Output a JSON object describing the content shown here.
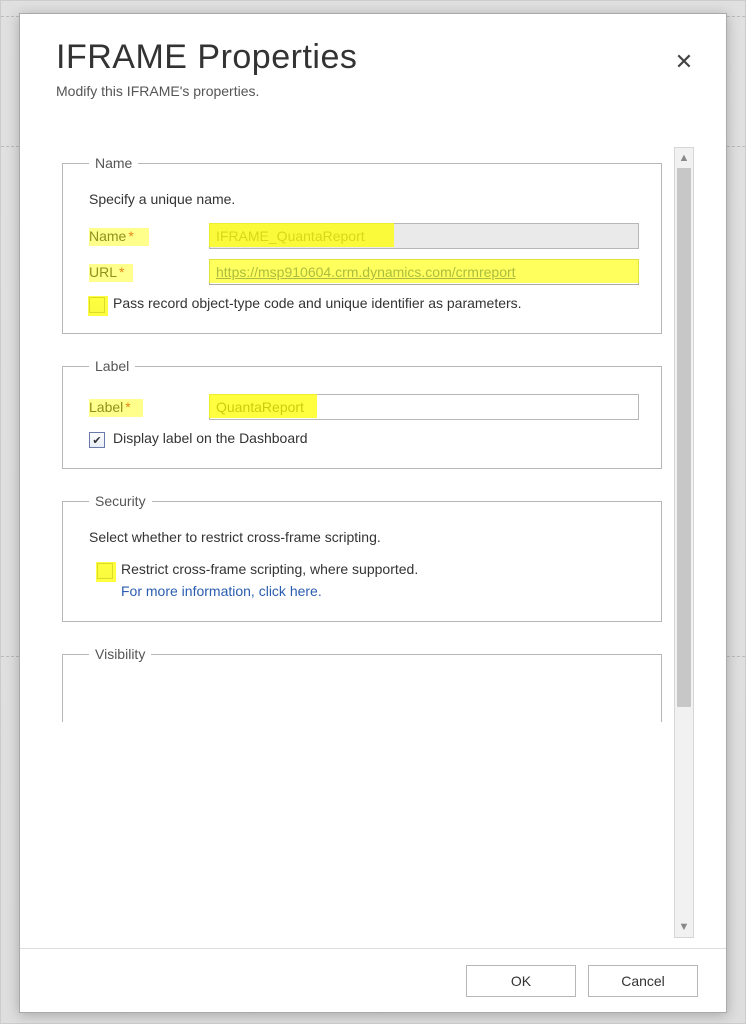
{
  "dialog": {
    "title": "IFRAME Properties",
    "subtitle": "Modify this IFRAME's properties.",
    "close_icon": "✕"
  },
  "groups": {
    "name": {
      "legend": "Name",
      "desc": "Specify a unique name.",
      "name_label": "Name",
      "name_value": "IFRAME_QuantaReport",
      "url_label": "URL",
      "url_value": "https://msp910604.crm.dynamics.com/crmreport",
      "pass_params_label": "Pass record object-type code and unique identifier as parameters."
    },
    "label": {
      "legend": "Label",
      "label_label": "Label",
      "label_value": "QuantaReport",
      "display_label_label": "Display label on the Dashboard"
    },
    "security": {
      "legend": "Security",
      "desc": "Select whether to restrict cross-frame scripting.",
      "restrict_label": "Restrict cross-frame scripting, where supported.",
      "more_info": "For more information, click here."
    },
    "visibility": {
      "legend": "Visibility"
    }
  },
  "footer": {
    "ok": "OK",
    "cancel": "Cancel"
  },
  "scroll": {
    "up": "▲",
    "down": "▼"
  }
}
